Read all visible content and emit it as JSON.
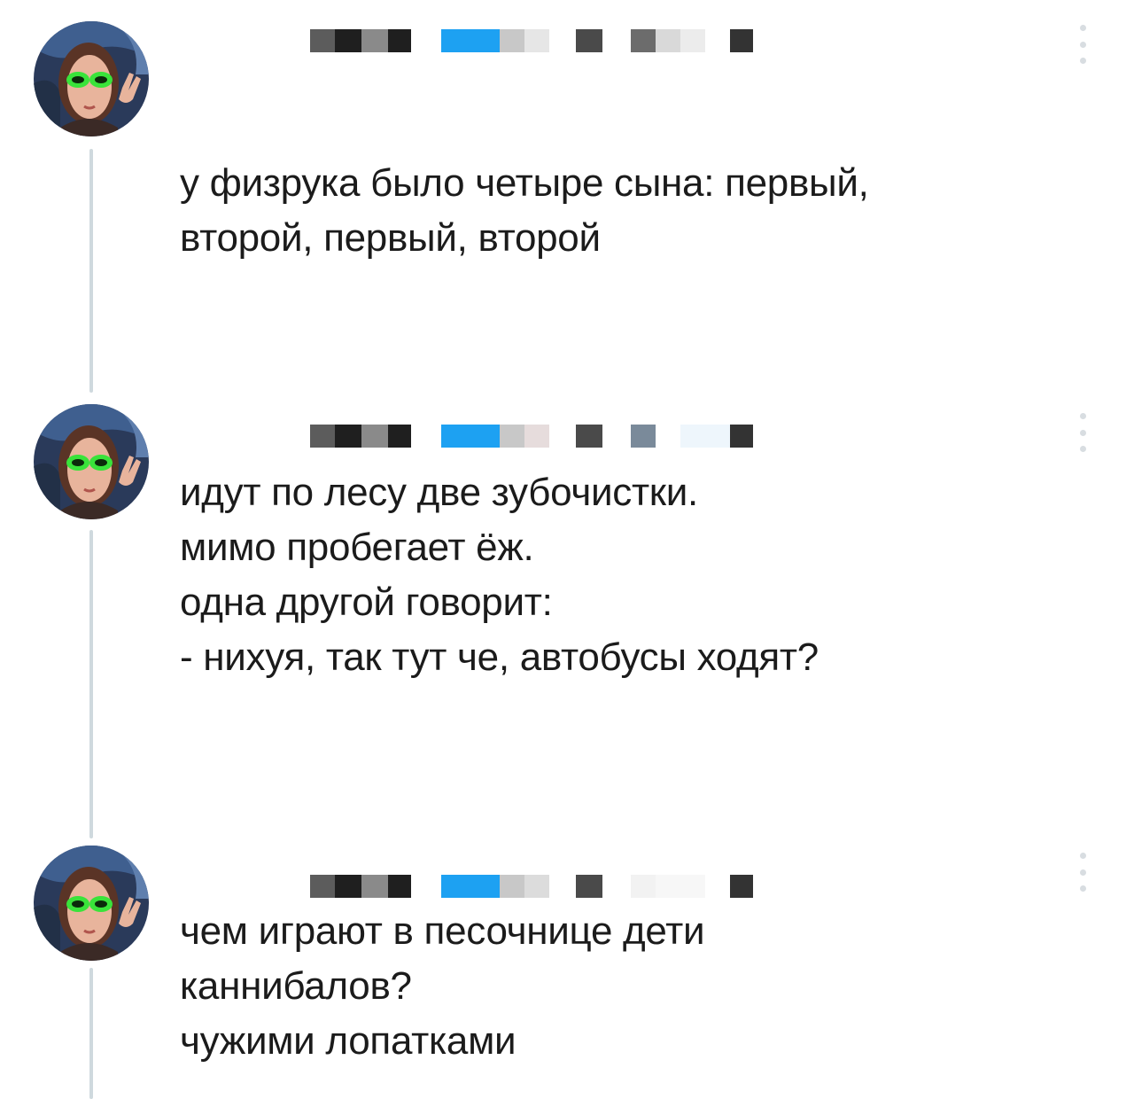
{
  "thread": {
    "posts": [
      {
        "author_name": "",
        "text": "у физрука было четыре сына: первый,\nвторой, первый, второй"
      },
      {
        "author_name": "",
        "text": "идут по лесу две зубочистки.\nмимо пробегает ёж.\nодна другой говорит:\n- нихуя, так тут че, автобусы ходят?"
      },
      {
        "author_name": "",
        "text": "чем играют в песочнице дети\nканнибалов?\nчужими лопатками"
      }
    ]
  },
  "icons": {
    "more": "more-vertical-icon",
    "avatar_glasses": "alien-glasses"
  },
  "colors": {
    "background": "#ffffff",
    "text": "#1b1b1b",
    "thread_line": "#cfd9de",
    "redaction_dark": "#1f1f1f",
    "redaction_gray": "#8a8a8a",
    "redaction_blue": "#1da1f2",
    "avatar_glasses": "#39e33a"
  }
}
